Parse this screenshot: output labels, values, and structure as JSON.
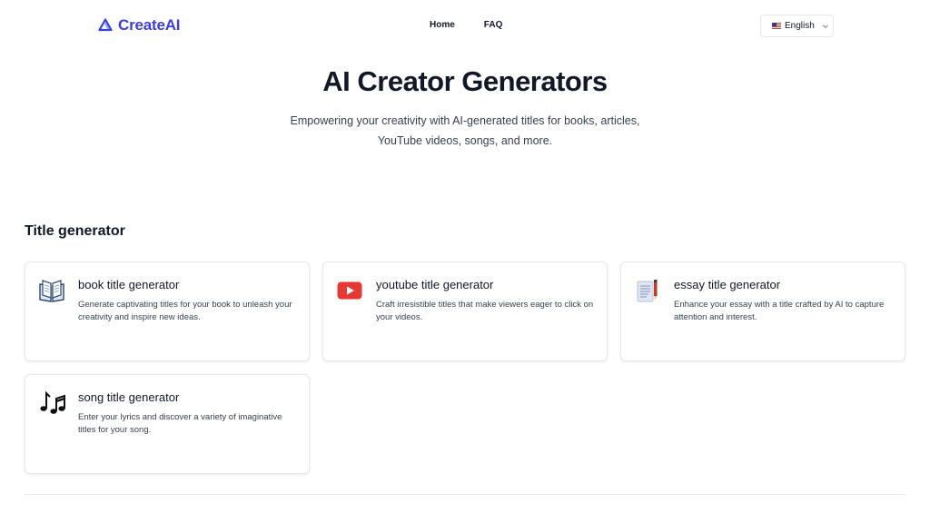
{
  "header": {
    "logo_text": "CreateAI",
    "nav": [
      {
        "label": "Home"
      },
      {
        "label": "FAQ"
      }
    ],
    "language": {
      "selected": "English",
      "flag_icon": "us-flag-icon"
    }
  },
  "hero": {
    "title": "AI Creator Generators",
    "subtitle_line1": "Empowering your creativity with AI-generated titles for books, articles,",
    "subtitle_line2": "YouTube videos, songs, and more."
  },
  "section": {
    "title": "Title generator",
    "cards": [
      {
        "icon": "book-icon",
        "title": "book title generator",
        "desc": "Generate captivating titles for your book to unleash your creativity and inspire new ideas."
      },
      {
        "icon": "youtube-icon",
        "title": "youtube title generator",
        "desc": "Craft irresistible titles that make viewers eager to click on your videos."
      },
      {
        "icon": "essay-icon",
        "title": "essay title generator",
        "desc": "Enhance your essay with a title crafted by AI to capture attention and interest."
      },
      {
        "icon": "music-notes-icon",
        "title": "song title generator",
        "desc": "Enter your lyrics and discover a variety of imaginative titles for your song."
      }
    ]
  },
  "colors": {
    "brand": "#3b3fd8",
    "youtube_red": "#e53935"
  }
}
